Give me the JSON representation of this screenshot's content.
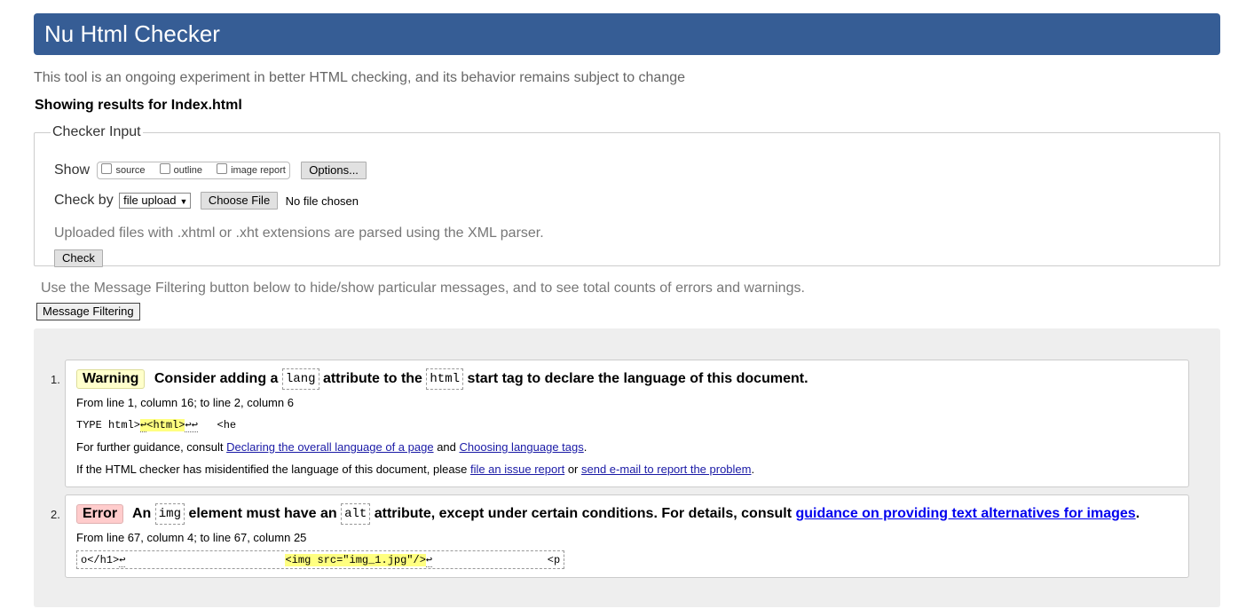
{
  "header": {
    "title": "Nu Html Checker"
  },
  "intro": "This tool is an ongoing experiment in better HTML checking, and its behavior remains subject to change",
  "results_for": "Showing results for Index.html",
  "checker_input": {
    "legend": "Checker Input",
    "show_label": "Show",
    "show_options": [
      "source",
      "outline",
      "image report"
    ],
    "options_button": "Options...",
    "check_by_label": "Check by",
    "check_by_value": "file upload",
    "choose_file_button": "Choose File",
    "no_file_text": "No file chosen",
    "xml_note": "Uploaded files with .xhtml or .xht extensions are parsed using the XML parser.",
    "check_button": "Check"
  },
  "filter_note": "Use the Message Filtering button below to hide/show particular messages, and to see total counts of errors and warnings.",
  "filter_button": "Message Filtering",
  "messages": [
    {
      "number": "1.",
      "type": "Warning",
      "text_1": "Consider adding a",
      "code_1": "lang",
      "text_2": "attribute to the",
      "code_2": "html",
      "text_3": "start tag to declare the language of this document.",
      "location": "From line 1, column 16; to line 2, column 6",
      "extract_before": "TYPE html>",
      "extract_highlight_ret": "↩",
      "extract_highlight": "<html>",
      "extract_ret": "↩↩",
      "extract_after": "   <he",
      "guidance_prefix": "For further guidance, consult",
      "guidance_link_1": "Declaring the overall language of a page",
      "guidance_and": "and",
      "guidance_link_2": "Choosing language tags",
      "guidance_end": ".",
      "misid_prefix": "If the HTML checker has misidentified the language of this document, please",
      "misid_link_1": "file an issue report",
      "misid_or": "or",
      "misid_link_2": "send e-mail to report the problem",
      "misid_end": "."
    },
    {
      "number": "2.",
      "type": "Error",
      "text_1": "An",
      "code_1": "img",
      "text_2": "element must have an",
      "code_2": "alt",
      "text_3": "attribute, except under certain conditions. For details, consult",
      "link": "guidance on providing text alternatives for images",
      "end": ".",
      "location": "From line 67, column 4; to line 67, column 25",
      "extract_before": "o</h1>",
      "extract_ret": "↩",
      "extract_spaces": "                         ",
      "extract_highlight": "<img src=\"img_1.jpg\"/>",
      "extract_ret_2": "↩",
      "extract_spaces_2": "                  ",
      "extract_after": "<p"
    }
  ]
}
